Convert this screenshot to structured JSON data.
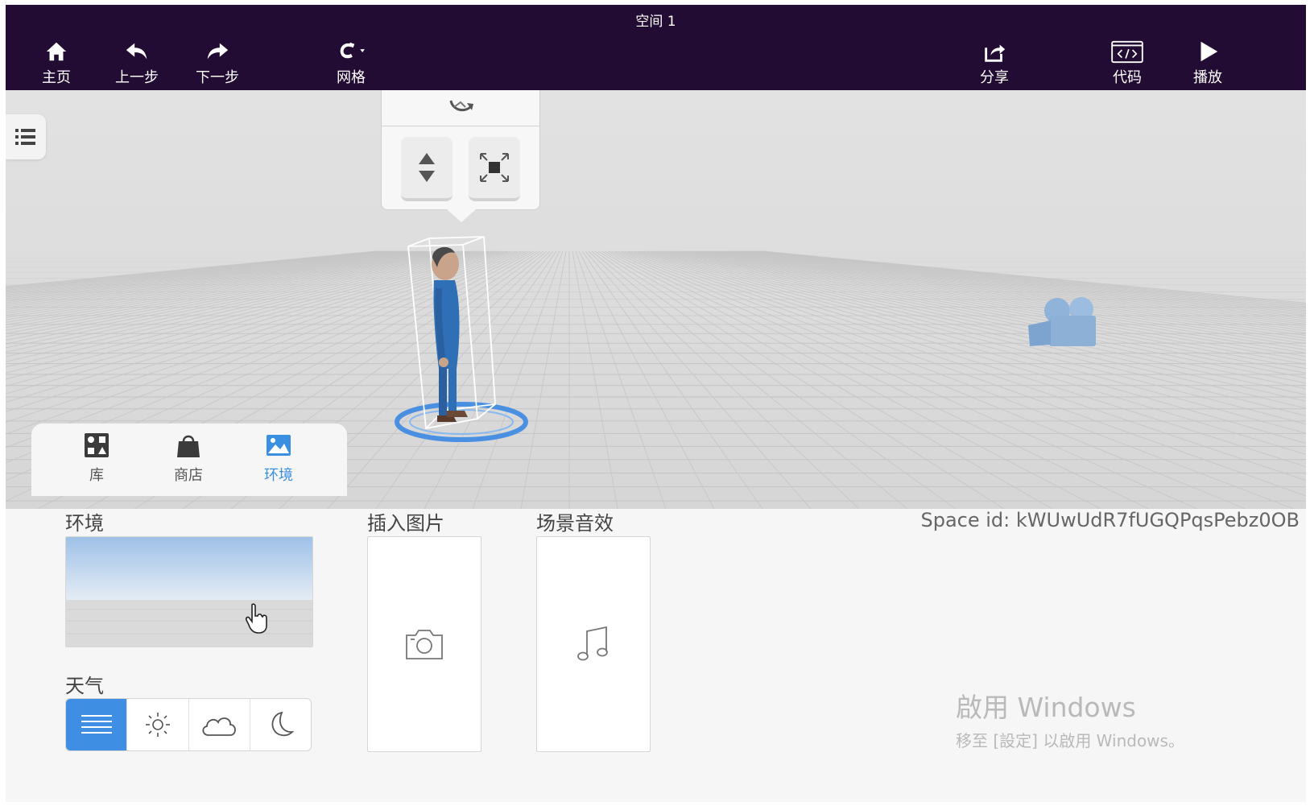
{
  "window": {
    "title": "空间 1"
  },
  "toolbar": {
    "home": {
      "label": "主页",
      "icon": "home-icon"
    },
    "undo": {
      "label": "上一步",
      "icon": "undo-icon"
    },
    "redo": {
      "label": "下一步",
      "icon": "redo-icon"
    },
    "grid": {
      "label": "网格",
      "icon": "magnet-icon"
    },
    "share": {
      "label": "分享",
      "icon": "share-icon"
    },
    "code": {
      "label": "代码",
      "icon": "code-icon"
    },
    "play": {
      "label": "播放",
      "icon": "play-icon"
    }
  },
  "viewport": {
    "sidebar_toggle_icon": "list-icon",
    "gizmo": {
      "rotate_icon": "rotate-icon",
      "move_vertical_icon": "move-vertical-icon",
      "scale_icon": "scale-icon"
    },
    "objects": [
      "character-model",
      "camera-model"
    ]
  },
  "tabs": [
    {
      "label": "库",
      "icon": "library-icon",
      "active": false
    },
    {
      "label": "商店",
      "icon": "shop-bag-icon",
      "active": false
    },
    {
      "label": "环境",
      "icon": "environment-icon",
      "active": true
    }
  ],
  "panel": {
    "environment_label": "环境",
    "weather_label": "天气",
    "weather_options": [
      {
        "icon": "fog-lines-icon",
        "active": true
      },
      {
        "icon": "sun-icon",
        "active": false
      },
      {
        "icon": "cloud-icon",
        "active": false
      },
      {
        "icon": "moon-icon",
        "active": false
      }
    ],
    "insert_image_label": "插入图片",
    "scene_sound_label": "场景音效",
    "space_id": "Space id: kWUwUdR7fUGQPqsPebz0OB"
  },
  "watermark": {
    "title": "啟用 Windows",
    "subtitle": "移至 [設定] 以啟用 Windows。"
  },
  "colors": {
    "topbar": "#230c33",
    "accent": "#3e8fe3",
    "background": "#f6f6f6"
  }
}
